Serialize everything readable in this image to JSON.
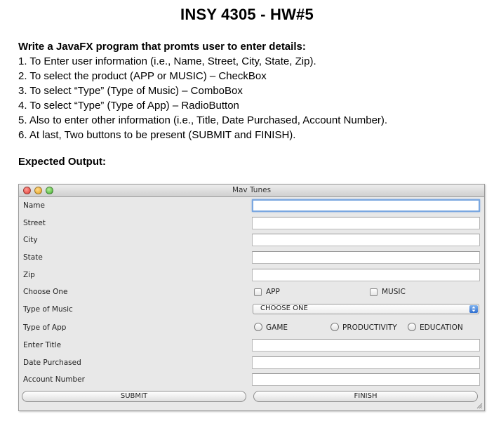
{
  "document": {
    "title": "INSY 4305 - HW#5",
    "heading": "Write a JavaFX program that promts user to enter details:",
    "items": [
      "1. To Enter user information (i.e., Name, Street, City, State, Zip).",
      "2. To select the product (APP or MUSIC) – CheckBox",
      "3. To select “Type” (Type of Music) – ComboBox",
      "4. To select “Type” (Type of App) – RadioButton",
      "5. Also to enter other information (i.e., Title, Date Purchased, Account Number).",
      "6. At last, Two buttons to be present (SUBMIT and FINISH)."
    ],
    "expected_label": "Expected Output:"
  },
  "window": {
    "title": "Mav Tunes",
    "labels": {
      "name": "Name",
      "street": "Street",
      "city": "City",
      "state": "State",
      "zip": "Zip",
      "choose_one": "Choose One",
      "type_of_music": "Type of Music",
      "type_of_app": "Type of App",
      "enter_title": "Enter Title",
      "date_purchased": "Date Purchased",
      "account_number": "Account Number"
    },
    "fields": {
      "name": "",
      "street": "",
      "city": "",
      "state": "",
      "zip": "",
      "enter_title": "",
      "date_purchased": "",
      "account_number": ""
    },
    "checkboxes": {
      "app": "APP",
      "music": "MUSIC"
    },
    "combo": {
      "selected": "CHOOSE ONE"
    },
    "radios": {
      "game": "GAME",
      "productivity": "PRODUCTIVITY",
      "education": "EDUCATION"
    },
    "buttons": {
      "submit": "SUBMIT",
      "finish": "FINISH"
    },
    "colors": {
      "focus_ring": "#7aa7e0",
      "combo_arrow": "#2f6fd0",
      "close": "#e0372f",
      "minimize": "#e6a21a",
      "zoom": "#3cae2c"
    }
  }
}
